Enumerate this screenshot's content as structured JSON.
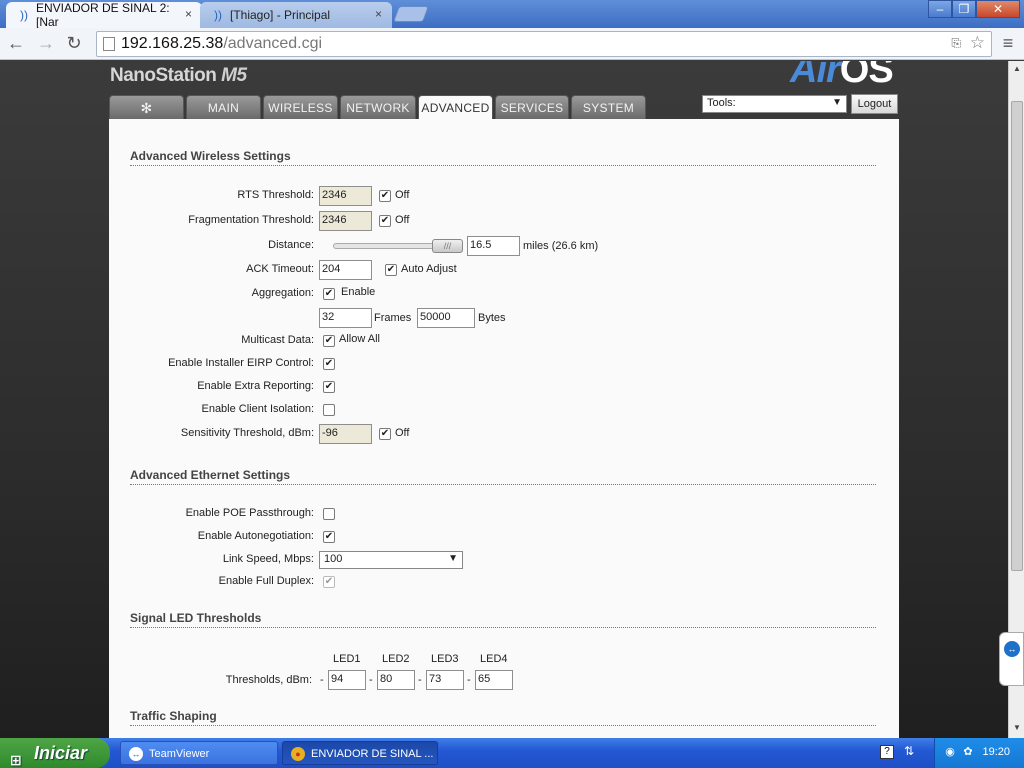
{
  "browser": {
    "tabs": [
      {
        "title": "ENVIADOR DE SINAL 2: [Nar",
        "close": "×"
      },
      {
        "title": "[Thiago] - Principal",
        "close": "×"
      }
    ],
    "window_buttons": {
      "minimize": "–",
      "restore": "❐",
      "close": "✕"
    },
    "url_host": "192.168.25.38",
    "url_path": "/advanced.cgi"
  },
  "header": {
    "brand": "NanoStation",
    "brand_model": "M5",
    "logo_air": "Air",
    "logo_os": "OS",
    "tabs": [
      {
        "label": " "
      },
      {
        "label": "MAIN"
      },
      {
        "label": "WIRELESS"
      },
      {
        "label": "NETWORK"
      },
      {
        "label": "ADVANCED"
      },
      {
        "label": "SERVICES"
      },
      {
        "label": "SYSTEM"
      }
    ],
    "tools_label": "Tools:",
    "logout_label": "Logout"
  },
  "wireless": {
    "title": "Advanced Wireless Settings",
    "rts_label": "RTS Threshold:",
    "rts_value": "2346",
    "rts_off": "Off",
    "frag_label": "Fragmentation Threshold:",
    "frag_value": "2346",
    "frag_off": "Off",
    "distance_label": "Distance:",
    "distance_value": "16.5",
    "distance_unit": "miles (26.6 km)",
    "ack_label": "ACK Timeout:",
    "ack_value": "204",
    "ack_auto": "Auto Adjust",
    "aggregation_label": "Aggregation:",
    "aggregation_enable": "Enable",
    "frames_value": "32",
    "frames_label": "Frames",
    "bytes_value": "50000",
    "bytes_label": "Bytes",
    "multicast_label": "Multicast Data:",
    "multicast_allow": "Allow All",
    "eirp_label": "Enable Installer EIRP Control:",
    "extra_label": "Enable Extra Reporting:",
    "isolation_label": "Enable Client Isolation:",
    "sensitivity_label": "Sensitivity Threshold, dBm:",
    "sensitivity_value": "-96",
    "sensitivity_off": "Off"
  },
  "ethernet": {
    "title": "Advanced Ethernet Settings",
    "poe_label": "Enable POE Passthrough:",
    "autoneg_label": "Enable Autonegotiation:",
    "speed_label": "Link Speed, Mbps:",
    "speed_value": "100",
    "duplex_label": "Enable Full Duplex:"
  },
  "led": {
    "title": "Signal LED Thresholds",
    "headers": [
      "LED1",
      "LED2",
      "LED3",
      "LED4"
    ],
    "label": "Thresholds, dBm:",
    "dash": "-",
    "values": [
      "94",
      "80",
      "73",
      "65"
    ]
  },
  "traffic": {
    "title": "Traffic Shaping"
  },
  "taskbar": {
    "start": "Iniciar",
    "tasks": [
      {
        "label": "TeamViewer"
      },
      {
        "label": "ENVIADOR DE SINAL ..."
      }
    ],
    "clock": "19:20",
    "help": "?"
  }
}
